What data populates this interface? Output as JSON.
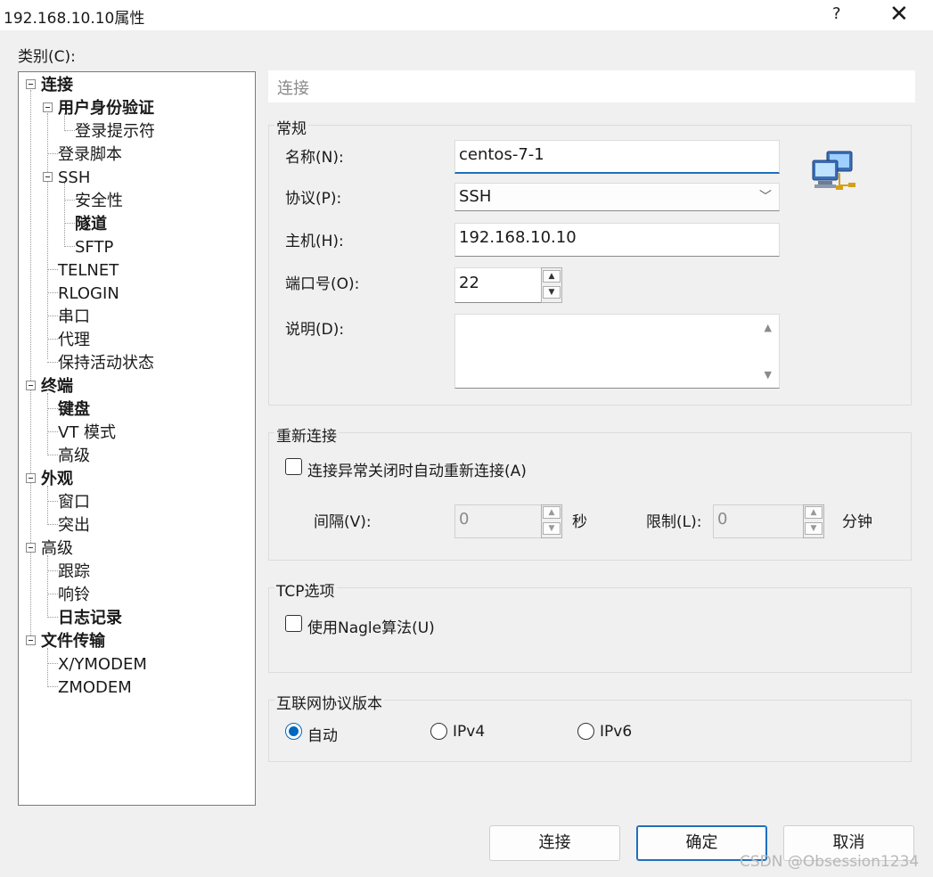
{
  "window": {
    "title": "192.168.10.10属性",
    "help": "?",
    "close": "✕"
  },
  "category_label": "类别(C):",
  "tree": [
    {
      "label": "连接",
      "bold": true,
      "expanded": true
    },
    {
      "label": "用户身份验证",
      "bold": true,
      "expanded": true
    },
    {
      "label": "登录提示符",
      "bold": false
    },
    {
      "label": "登录脚本",
      "bold": false
    },
    {
      "label": "SSH",
      "bold": false,
      "expanded": true
    },
    {
      "label": "安全性",
      "bold": false
    },
    {
      "label": "隧道",
      "bold": true
    },
    {
      "label": "SFTP",
      "bold": false
    },
    {
      "label": "TELNET",
      "bold": false
    },
    {
      "label": "RLOGIN",
      "bold": false
    },
    {
      "label": "串口",
      "bold": false
    },
    {
      "label": "代理",
      "bold": false
    },
    {
      "label": "保持活动状态",
      "bold": false
    },
    {
      "label": "终端",
      "bold": true,
      "expanded": true
    },
    {
      "label": "键盘",
      "bold": true
    },
    {
      "label": "VT 模式",
      "bold": false
    },
    {
      "label": "高级",
      "bold": false
    },
    {
      "label": "外观",
      "bold": true,
      "expanded": true
    },
    {
      "label": "窗口",
      "bold": false
    },
    {
      "label": "突出",
      "bold": false
    },
    {
      "label": "高级",
      "bold": false,
      "expanded": true
    },
    {
      "label": "跟踪",
      "bold": false
    },
    {
      "label": "响铃",
      "bold": false
    },
    {
      "label": "日志记录",
      "bold": true
    },
    {
      "label": "文件传输",
      "bold": true,
      "expanded": true
    },
    {
      "label": "X/YMODEM",
      "bold": false
    },
    {
      "label": "ZMODEM",
      "bold": false
    }
  ],
  "panel_title": "连接",
  "general": {
    "group_label": "常规",
    "name_label": "名称(N):",
    "name_value": "centos-7-1",
    "protocol_label": "协议(P):",
    "protocol_value": "SSH",
    "host_label": "主机(H):",
    "host_value": "192.168.10.10",
    "port_label": "端口号(O):",
    "port_value": "22",
    "desc_label": "说明(D):",
    "desc_value": ""
  },
  "reconnect": {
    "group_label": "重新连接",
    "checkbox_label": "连接异常关闭时自动重新连接(A)",
    "checked": false,
    "interval_label": "间隔(V):",
    "interval_value": "0",
    "interval_unit": "秒",
    "limit_label": "限制(L):",
    "limit_value": "0",
    "limit_unit": "分钟"
  },
  "tcp": {
    "group_label": "TCP选项",
    "checkbox_label": "使用Nagle算法(U)",
    "checked": false
  },
  "ip_version": {
    "group_label": "互联网协议版本",
    "options": [
      "自动",
      "IPv4",
      "IPv6"
    ],
    "selected": "自动"
  },
  "buttons": {
    "connect": "连接",
    "ok": "确定",
    "cancel": "取消"
  },
  "watermark": "CSDN @Obsession1234",
  "colors": {
    "accent": "#0067c0",
    "dialog_bg": "#f0f0f0"
  }
}
